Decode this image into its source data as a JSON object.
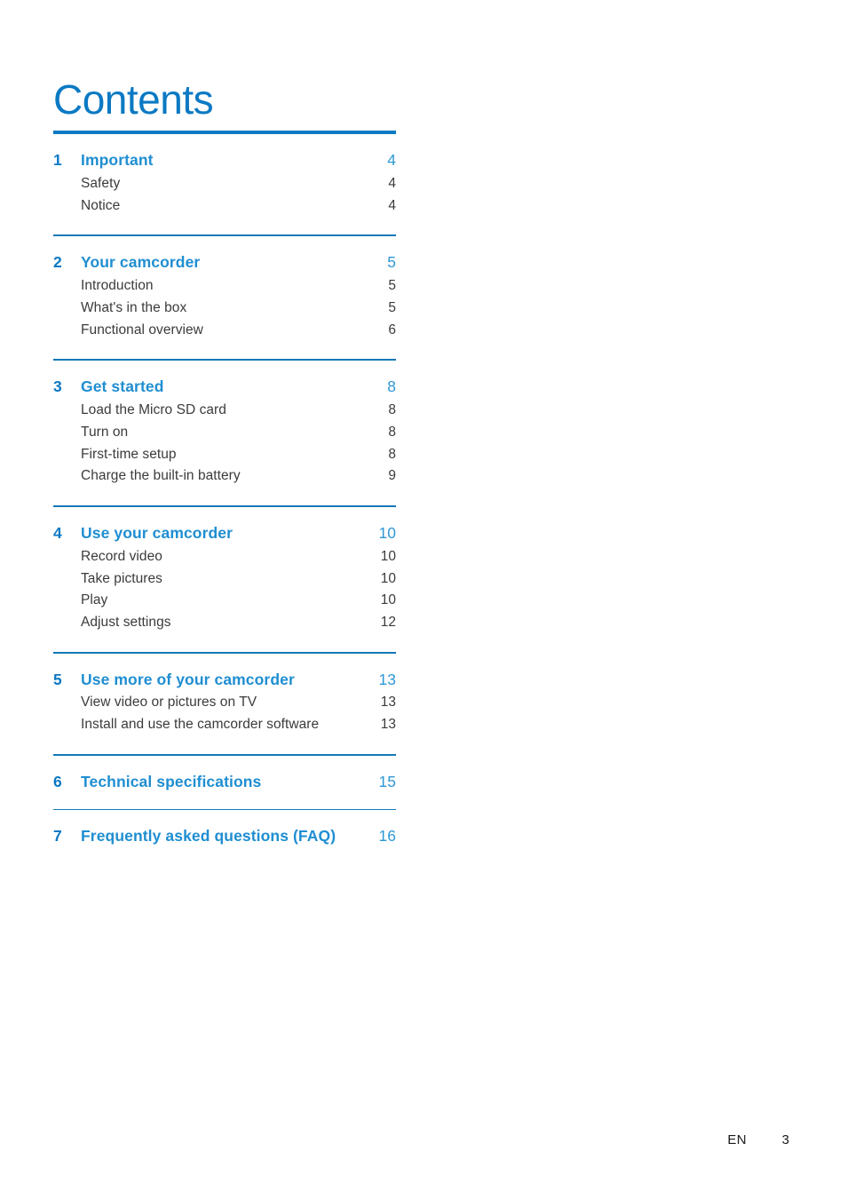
{
  "document": {
    "title": "Contents",
    "language_code": "EN",
    "page_number": "3"
  },
  "theme": {
    "accent_blue": "#0b79c3",
    "chapter_blue": "#1f8ed1",
    "chapter_page_blue": "#2f97d6",
    "body_gray": "#3b3b3b"
  },
  "toc": {
    "groups": [
      {
        "chapter": {
          "number": "1",
          "label": "Important",
          "page": "4"
        },
        "entries": [
          {
            "label": "Safety",
            "page": "4"
          },
          {
            "label": "Notice",
            "page": "4"
          }
        ]
      },
      {
        "chapter": {
          "number": "2",
          "label": "Your camcorder",
          "page": "5"
        },
        "entries": [
          {
            "label": "Introduction",
            "page": "5"
          },
          {
            "label": "What's in the box",
            "page": "5"
          },
          {
            "label": "Functional overview",
            "page": "6"
          }
        ]
      },
      {
        "chapter": {
          "number": "3",
          "label": "Get started",
          "page": "8"
        },
        "entries": [
          {
            "label": "Load the Micro SD card",
            "page": "8"
          },
          {
            "label": "Turn on",
            "page": "8"
          },
          {
            "label": "First-time setup",
            "page": "8"
          },
          {
            "label": "Charge the built-in battery",
            "page": "9"
          }
        ]
      },
      {
        "chapter": {
          "number": "4",
          "label": "Use your camcorder",
          "page": "10"
        },
        "entries": [
          {
            "label": "Record video",
            "page": "10"
          },
          {
            "label": "Take pictures",
            "page": "10"
          },
          {
            "label": "Play",
            "page": "10"
          },
          {
            "label": "Adjust settings",
            "page": "12"
          }
        ]
      },
      {
        "chapter": {
          "number": "5",
          "label": "Use more of your camcorder",
          "page": "13"
        },
        "entries": [
          {
            "label": "View video or pictures on TV",
            "page": "13"
          },
          {
            "label": "Install and use the camcorder software",
            "page": "13"
          }
        ]
      },
      {
        "chapter": {
          "number": "6",
          "label": "Technical specifications",
          "page": "15"
        },
        "entries": []
      },
      {
        "chapter": {
          "number": "7",
          "label": "Frequently asked questions (FAQ)",
          "page": "16"
        },
        "entries": []
      }
    ]
  }
}
